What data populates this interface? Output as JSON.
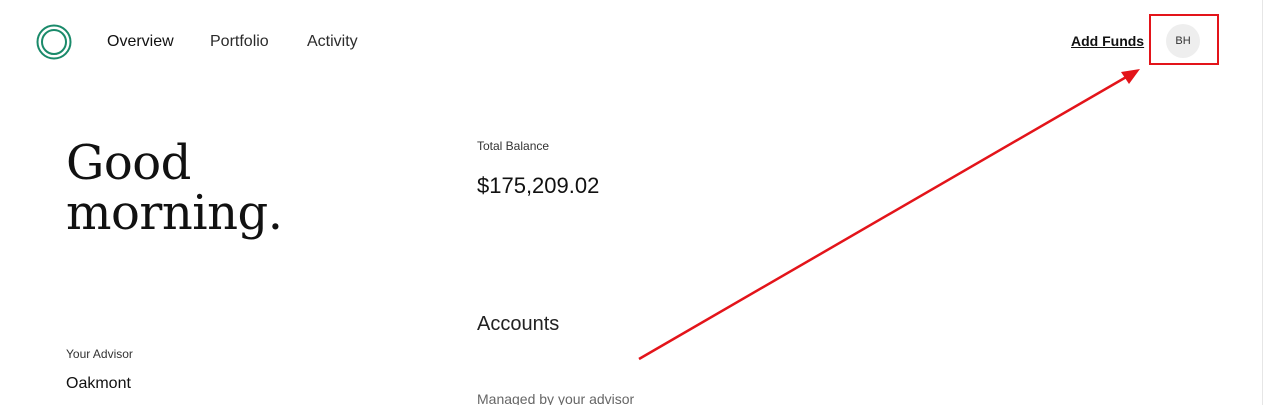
{
  "header": {
    "nav": [
      {
        "label": "Overview"
      },
      {
        "label": "Portfolio"
      },
      {
        "label": "Activity"
      }
    ],
    "add_funds_label": "Add Funds",
    "avatar_initials": "BH"
  },
  "main": {
    "greeting_line1": "Good",
    "greeting_line2": "morning.",
    "total_balance_label": "Total Balance",
    "total_balance_value": "$175,209.02",
    "accounts_heading": "Accounts",
    "managed_label": "Managed by your advisor",
    "advisor_label": "Your Advisor",
    "advisor_name": "Oakmont"
  },
  "colors": {
    "logo_green": "#1a8a6a",
    "annotation_red": "#e3141a"
  },
  "icons": {
    "logo": "ring-logo-icon"
  }
}
